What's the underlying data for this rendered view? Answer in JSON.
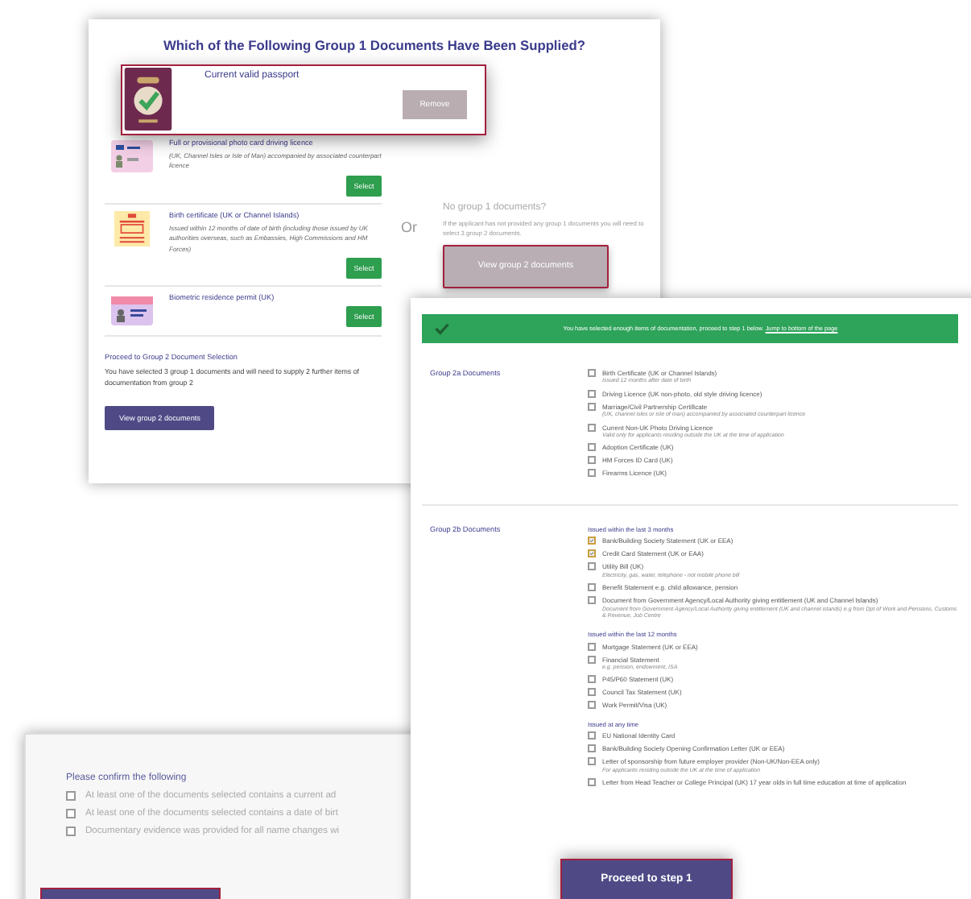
{
  "group1_panel": {
    "title": "Which of the Following Group 1 Documents Have Been Supplied?",
    "documents": [
      {
        "kind": "licence",
        "name": "Full or provisional photo card driving licence",
        "description": "(UK, Channel Isles or Isle of Man) accompanied by associated counterpart licence",
        "button": "Select"
      },
      {
        "kind": "certificate",
        "name": "Birth certificate (UK or Channel Islands)",
        "description": "Issued within 12 months of date of birth (including those issued by UK authorities overseas, such as Embassies, High Commissions and HM Forces)",
        "button": "Select"
      },
      {
        "kind": "permit",
        "name": "Biometric residence permit (UK)",
        "button": "Select"
      }
    ],
    "proceed": {
      "heading": "Proceed to Group 2 Document Selection",
      "text": "You have selected 3 group 1 documents and will need to supply 2 further items of documentation from group 2",
      "button": "View group 2 documents"
    },
    "separator": "Or",
    "alternative": {
      "heading": "No group 1 documents?",
      "text": "If the applicant has not provided any group 1 documents you will need to select 3 group 2 documents.",
      "button": "View group 2 documents"
    }
  },
  "selected_document": {
    "kind": "passport",
    "name": "Current valid passport",
    "button": "Remove"
  },
  "group2_panel": {
    "banner": {
      "text": "You have selected enough items of documentation, proceed to step 1 below.",
      "link": "Jump to bottom of the page"
    },
    "sections": [
      {
        "title": "Group 2a Documents",
        "groups": [
          {
            "items": [
              {
                "label": "Birth Certificate (UK or Channel Islands)",
                "note": "Issued 12 months after date of birth",
                "checked": false
              },
              {
                "label": "Driving Licence (UK non-photo, old style driving licence)",
                "checked": false
              },
              {
                "label": "Marriage/Civil Partnership Certificate",
                "note": "(UK, channel isles or isle of man) accompanied by associated counterpart licence",
                "checked": false
              },
              {
                "label": "Current Non-UK Photo Driving Licence",
                "note": "Valid only for applicants residing outside the UK at the time of application",
                "checked": false
              },
              {
                "label": "Adoption Certificate (UK)",
                "checked": false
              },
              {
                "label": "HM Forces ID Card (UK)",
                "checked": false
              },
              {
                "label": "Firearms Licence (UK)",
                "checked": false
              }
            ]
          }
        ]
      },
      {
        "title": "Group 2b Documents",
        "groups": [
          {
            "heading": "Issued within the last 3 months",
            "items": [
              {
                "label": "Bank/Building Society Statement (UK or EEA)",
                "checked": true
              },
              {
                "label": "Credit Card Statement (UK or EAA)",
                "checked": true
              },
              {
                "label": "Utility Bill (UK)",
                "note": "Electricity, gas, water, telephone - not mobile phone bill",
                "checked": false
              },
              {
                "label": "Benefit Statement e.g. child allowance, pension",
                "checked": false
              },
              {
                "label": "Document from Government Agency/Local Authority giving entitlement (UK and Channel Islands)",
                "note": "Document from Government Agency/Local Authority giving entitlement (UK and channel islands) e.g from Dpt of Work and Pensions, Customs & Revenue, Job Centre",
                "checked": false
              }
            ]
          },
          {
            "heading": "Issued within the last 12 months",
            "items": [
              {
                "label": "Mortgage Statement (UK or EEA)",
                "checked": false
              },
              {
                "label": "Financial Statement",
                "note": "e.g. pension, endowment, ISA",
                "checked": false
              },
              {
                "label": "P45/P60 Statement (UK)",
                "checked": false
              },
              {
                "label": "Council Tax Statement (UK)",
                "checked": false
              },
              {
                "label": "Work Permit/Visa (UK)",
                "checked": false
              }
            ]
          },
          {
            "heading": "Issued at any time",
            "items": [
              {
                "label": "EU National Identity Card",
                "checked": false
              },
              {
                "label": "Bank/Building Society Opening Confirmation Letter (UK or EEA)",
                "checked": false
              },
              {
                "label": "Letter of sponsorship from future employer provider (Non-UK/Non-EEA only)",
                "note": "For applicants residing outside the UK at the time of application",
                "checked": false
              },
              {
                "label": "Letter from Head Teacher or College Principal (UK) 17 year olds in full time education at time of application",
                "checked": false
              }
            ]
          }
        ]
      }
    ],
    "button": "Proceed to step 1"
  },
  "confirm_panel": {
    "heading": "Please confirm the following",
    "items": [
      {
        "label": "At least one of the documents selected contains a current ad",
        "checked": false
      },
      {
        "label": "At least one of the documents selected contains a date of birt",
        "checked": false
      },
      {
        "label": "Documentary evidence was provided for all name changes wi",
        "checked": false
      }
    ]
  }
}
